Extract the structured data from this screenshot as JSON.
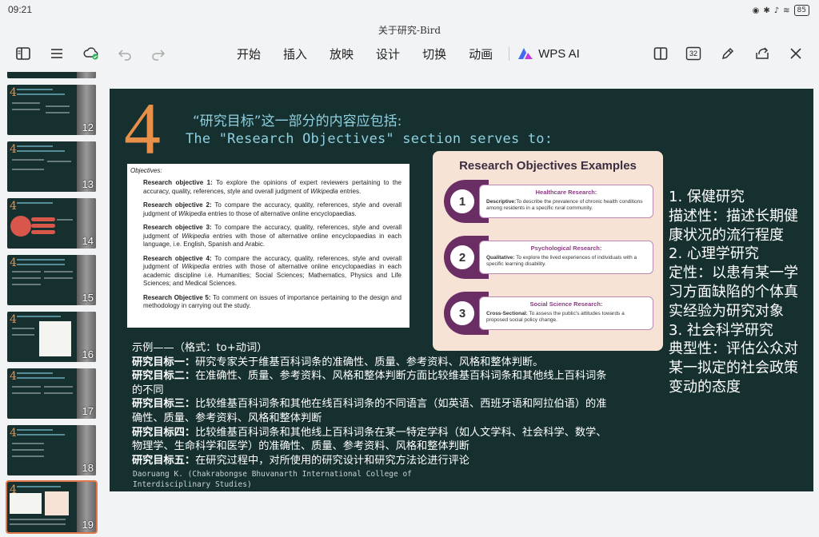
{
  "status": {
    "time": "09:21",
    "battery": "85"
  },
  "doc_title": "关于研究-Bird",
  "menu": {
    "items": [
      "开始",
      "插入",
      "放映",
      "设计",
      "切换",
      "动画"
    ],
    "wps_ai": "WPS AI"
  },
  "toolbar": {
    "page_count": "32"
  },
  "thumbnails": [
    {
      "number": "12"
    },
    {
      "number": "13"
    },
    {
      "number": "14"
    },
    {
      "number": "15"
    },
    {
      "number": "16"
    },
    {
      "number": "17"
    },
    {
      "number": "18"
    },
    {
      "number": "19"
    }
  ],
  "slide": {
    "big_number": "4",
    "heading_cn": "“研究目标”这一部分的内容应包括:",
    "heading_en": "The \"Research Objectives\" section serves  to:",
    "objectives_box": {
      "header": "Objectives:",
      "items": [
        {
          "label": "Research objective 1:",
          "text": " To explore the opinions of expert reviewers pertaining to the accuracy, quality, references, style and overall judgment of ",
          "italic": "Wikipedia",
          "tail": " entries."
        },
        {
          "label": "Research objective 2:",
          "text": " To compare the accuracy, quality, references, style and overall judgment of ",
          "italic": "Wikipedia",
          "tail": " entries to those of alternative online encyclopaedias."
        },
        {
          "label": "Research objective 3:",
          "text": " To compare the accuracy, quality, references, style and overall judgment of ",
          "italic": "Wikipedia",
          "tail": " entries with those of alternative online encyclopaedias in each language, i.e. English, Spanish and Arabic."
        },
        {
          "label": "Research objective 4:",
          "text": " To compare the accuracy, quality, references, style and overall judgment of ",
          "italic": "Wikipedia",
          "tail": " entries with those of alternative online encyclopaedias in each academic discipline i.e. Humanities; Social Sciences; Mathematics, Physics and Life Sciences; and Medical Sciences."
        },
        {
          "label": "Research Objective 5:",
          "text": " To comment on issues of importance pertaining to the design and methodology in carrying out the study.",
          "italic": "",
          "tail": ""
        }
      ]
    },
    "infographic": {
      "title": "Research Objectives Examples",
      "items": [
        {
          "num": "1",
          "title": "Healthcare Research:",
          "label": "Descriptive:",
          "desc": "To describe the prevalence of chronic health conditions among residents in a specific rural community."
        },
        {
          "num": "2",
          "title": "Psychological Research:",
          "label": "Qualitative:",
          "desc": " To explore the lived experiences of individuals with a specific learning disability."
        },
        {
          "num": "3",
          "title": "Social Science Research:",
          "label": "Cross-Sectional:",
          "desc": " To assess the public's attitudes towards a proposed social policy change."
        }
      ]
    },
    "right_text": [
      "1. 保健研究",
      "描述性：描述长期健",
      "康状况的流行程度",
      "2. 心理学研究",
      "定性：以患有某一学",
      "习方面缺陷的个体真",
      "实经验为研究对象",
      "3. 社会科学研究",
      "典型性：评估公众对",
      "某一拟定的社会政策",
      "变动的态度"
    ],
    "bottom": {
      "example_label": "示例——（格式：to+动词）",
      "lines": [
        {
          "label": "研究目标一：",
          "text": "研究专家关于维基百科词条的准确性、质量、参考资料、风格和整体判断。"
        },
        {
          "label": "研究目标二：",
          "text": "在准确性、质量、参考资料、风格和整体判断方面比较维基百科词条和其他线上百科词条的不同"
        },
        {
          "label": "研究目标三：",
          "text": "比较维基百科词条和其他在线百科词条的不同语言（如英语、西班牙语和阿拉伯语）的准确性、质量、参考资料、风格和整体判断"
        },
        {
          "label": "研究目标四：",
          "text": "比较维基百科词条和其他线上百科词条在某一特定学科（如人文学科、社会科学、数学、物理学、生命科学和医学）的准确性、质量、参考资料、风格和整体判断"
        },
        {
          "label": "研究目标五：",
          "text": "在研究过程中，对所使用的研究设计和研究方法论进行评论"
        }
      ]
    },
    "credit": "Daoruang K. (Chakrabongse Bhuvanarth International College of Interdisciplinary Studies)"
  }
}
